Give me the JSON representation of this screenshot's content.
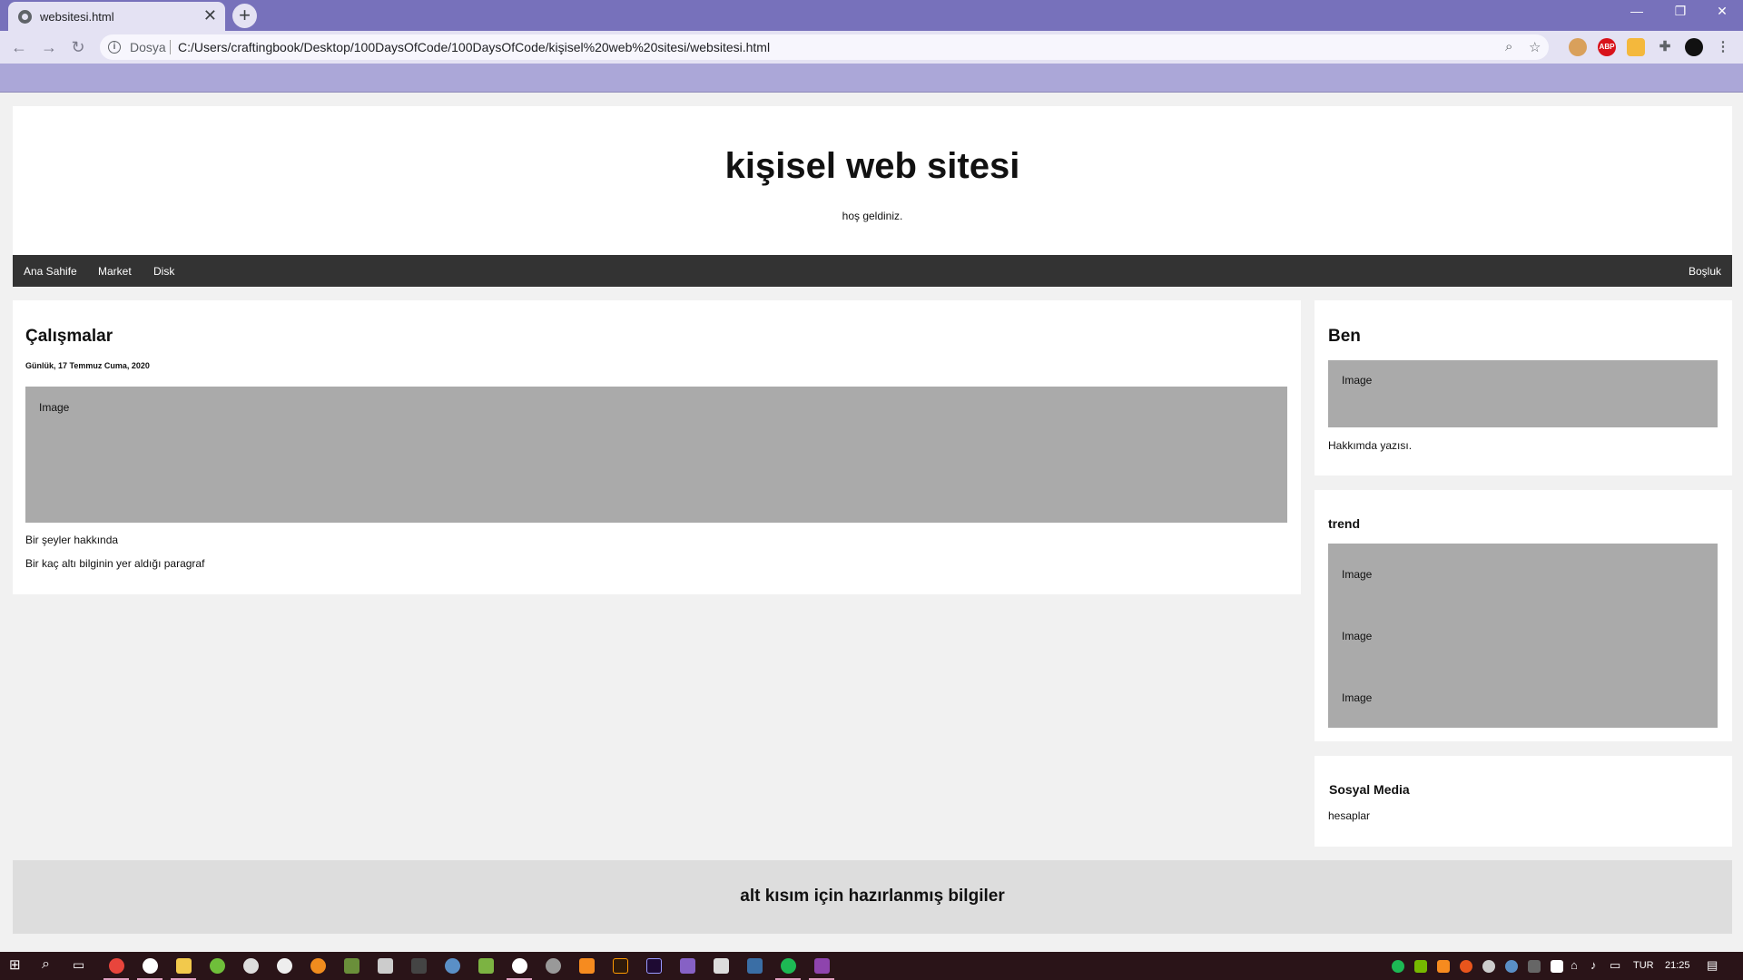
{
  "browser": {
    "tab_title": "websitesi.html",
    "tab_close": "✕",
    "new_tab": "+",
    "scheme_label": "Dosya",
    "url": "C:/Users/craftingbook/Desktop/100DaysOfCode/100DaysOfCode/kişisel%20web%20sitesi/websitesi.html",
    "window_controls": {
      "minimize": "—",
      "restore": "❐",
      "close": "✕"
    },
    "extension_label": "ABP"
  },
  "header": {
    "title": "kişisel web sitesi",
    "subtitle": "hoş geldiniz."
  },
  "nav": {
    "items": [
      "Ana Sahife",
      "Market",
      "Disk"
    ],
    "right_item": "Boşluk"
  },
  "main": {
    "title": "Çalışmalar",
    "date": "Günlük, 17 Temmuz Cuma, 2020",
    "image_label": "Image",
    "paragraph1": "Bir şeyler hakkında",
    "paragraph2": "Bir kaç altı bilginin yer aldığı paragraf"
  },
  "sidebar": {
    "about": {
      "title": "Ben",
      "image_label": "Image",
      "text": "Hakkımda yazısı."
    },
    "trend": {
      "title": "trend",
      "image_labels": [
        "Image",
        "Image",
        "Image"
      ]
    },
    "social": {
      "title": "Sosyal Media",
      "text": "hesaplar"
    }
  },
  "footer": {
    "text": "alt kısım için hazırlanmış bilgiler"
  },
  "taskbar": {
    "language": "TUR",
    "time": "21:25"
  }
}
